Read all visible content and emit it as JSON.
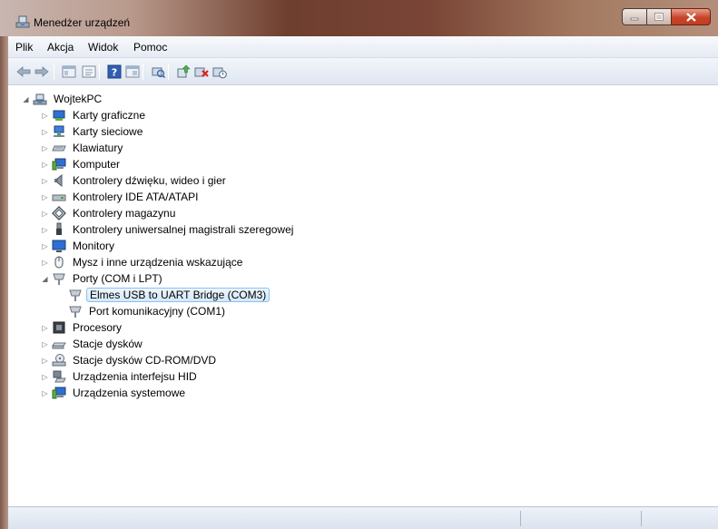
{
  "window": {
    "title": "Menedżer urządzeń"
  },
  "menu": {
    "items": [
      "Plik",
      "Akcja",
      "Widok",
      "Pomoc"
    ]
  },
  "toolbar": {
    "buttons": [
      "back-arrow-icon",
      "forward-arrow-icon",
      "show-hide-tree-icon",
      "properties-icon",
      "help-icon",
      "view-icon",
      "scan-hardware-icon",
      "update-driver-icon",
      "uninstall-icon",
      "disable-icon"
    ]
  },
  "tree": {
    "root": "WojtekPC",
    "nodes": [
      {
        "label": "Karty graficzne",
        "icon": "display-adapter-icon"
      },
      {
        "label": "Karty sieciowe",
        "icon": "network-adapter-icon"
      },
      {
        "label": "Klawiatury",
        "icon": "keyboard-icon"
      },
      {
        "label": "Komputer",
        "icon": "computer-icon"
      },
      {
        "label": "Kontrolery dźwięku, wideo i gier",
        "icon": "speaker-icon"
      },
      {
        "label": "Kontrolery IDE ATA/ATAPI",
        "icon": "ide-controller-icon"
      },
      {
        "label": "Kontrolery magazynu",
        "icon": "storage-controller-icon"
      },
      {
        "label": "Kontrolery uniwersalnej magistrali szeregowej",
        "icon": "usb-icon"
      },
      {
        "label": "Monitory",
        "icon": "monitor-icon"
      },
      {
        "label": "Mysz i inne urządzenia wskazujące",
        "icon": "mouse-icon"
      },
      {
        "label": "Porty (COM i LPT)",
        "icon": "port-icon",
        "expanded": true,
        "children": [
          {
            "label": "Elmes USB to UART Bridge (COM3)",
            "icon": "port-icon",
            "selected": true
          },
          {
            "label": "Port komunikacyjny (COM1)",
            "icon": "port-icon"
          }
        ]
      },
      {
        "label": "Procesory",
        "icon": "processor-icon"
      },
      {
        "label": "Stacje dysków",
        "icon": "disk-drive-icon"
      },
      {
        "label": "Stacje dysków CD-ROM/DVD",
        "icon": "cdrom-icon"
      },
      {
        "label": "Urządzenia interfejsu HID",
        "icon": "hid-icon"
      },
      {
        "label": "Urządzenia systemowe",
        "icon": "system-device-icon"
      }
    ]
  }
}
